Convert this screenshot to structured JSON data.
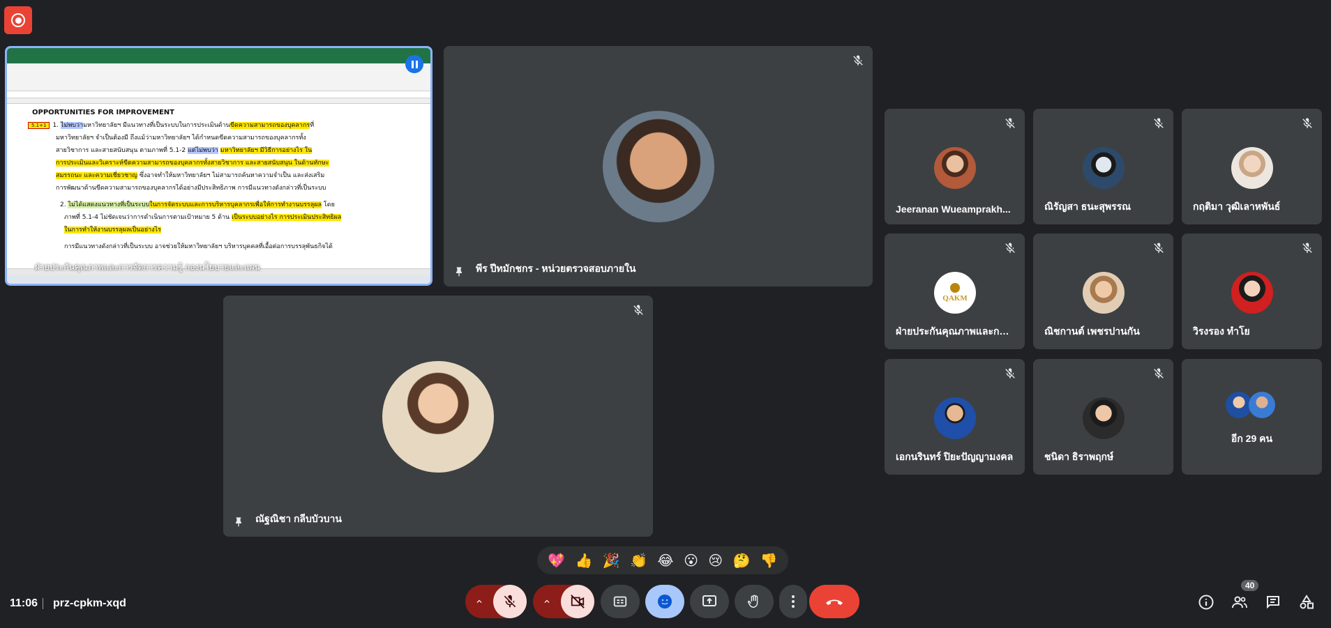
{
  "meeting": {
    "time": "11:06",
    "code": "prz-cpkm-xqd"
  },
  "screen_share": {
    "heading": "OPPORTUNITIES FOR IMPROVEMENT",
    "tag1": "5.1+1",
    "line1a": "ไม่พบว่า",
    "line1b": "มหาวิทยาลัยฯ มีแนวทางที่เป็นระบบในการประเมินด้าน",
    "line1c": "ขีดความสามารถของบุคลากร",
    "line1d": "ที่",
    "line2": "มหาวิทยาลัยฯ จำเป็นต้องมี ถึงแม้ว่ามหาวิทยาลัยฯ ได้กำหนดขีดความสามารถของบุคลากรทั้ง",
    "line3a": "สายวิชาการ และสายสนับสนุน ตามภาพที่ 5.1-2",
    "line3b": "แต่ไม่พบว่า",
    "line3c": "มหาวิทยาลัยฯ มีวิธีการอย่างไร ใน",
    "line4": "การประเมินและวิเคราะห์ขีดความสามารถของบุคลากรทั้งสายวิชาการ และสายสนับสนุน ในด้านทักษะ",
    "line5a": "สมรรถนะ และความเชี่ยวชาญ",
    "line5b": " ซึ่งอาจทำให้มหาวิทยาลัยฯ ไม่สามารถค้นหาความจำเป็น และส่งเสริม",
    "line6": "การพัฒนาด้านขีดความสามารถของบุคลากรได้อย่างมีประสิทธิภาพ การมีแนวทางดังกล่าวที่เป็นระบบ",
    "line7a": "ไม่ได้แสดงแนวทางที่เป็นระบบ",
    "line7b": "ในการจัดระบบและการบริหารบุคลากรเพื่อให้การทำงานบรรลุผล",
    "line7c": " โดย",
    "line8a": "ภาพที่ 5.1-4 ไม่ชัดเจนว่าการดำเนินการตามเป้าหมาย 5 ด้าน ",
    "line8b": "เป็นระบบอย่างไร การประเมินประสิทธิผล",
    "line9": "ในการทำให้งานบรรลุผลเป็นอย่างไร",
    "line10": "การมีแนวทางดังกล่าวที่เป็นระบบ อาจช่วยให้มหาวิทยาลัยฯ บริหารบุคคลที่เอื้อต่อการบรรลุพันธกิจได้",
    "caption": "ฝ่ายประกันคุณภาพและการจัดการความรู้ กองนโยบายและแผน"
  },
  "featured": [
    {
      "name": "พีร ปีทมักชกร - หน่วยตรวจสอบภายใน"
    },
    {
      "name": "ณัฐณิชา กลีบบัวบาน"
    }
  ],
  "participants": [
    {
      "name": "Jeeranan Wueamprakh..."
    },
    {
      "name": "ณิรัญสา ธนะสุพรรณ"
    },
    {
      "name": "กฤติมา วุฒิเลาหพันธ์"
    },
    {
      "name": "ฝ่ายประกันคุณภาพและการ..."
    },
    {
      "name": "ณิชกานต์ เพชรปานกัน"
    },
    {
      "name": "วิรงรอง ทำโย"
    },
    {
      "name": "เอกนรินทร์ ปิยะปัญญามงคล"
    },
    {
      "name": "ชนิดา ธิราพฤกษ์"
    }
  ],
  "more": {
    "label": "อีก 29 คน"
  },
  "qakm_logo": "QAKM",
  "reactions": [
    "💖",
    "👍",
    "🎉",
    "👏",
    "😂",
    "😮",
    "😢",
    "🤔",
    "👎"
  ],
  "people_count": "40",
  "colors": {
    "background": "#202124",
    "tile": "#3c4043",
    "end_call": "#ea4335",
    "active_blue": "#a8c7fa",
    "muted_red": "#8c1d18"
  }
}
